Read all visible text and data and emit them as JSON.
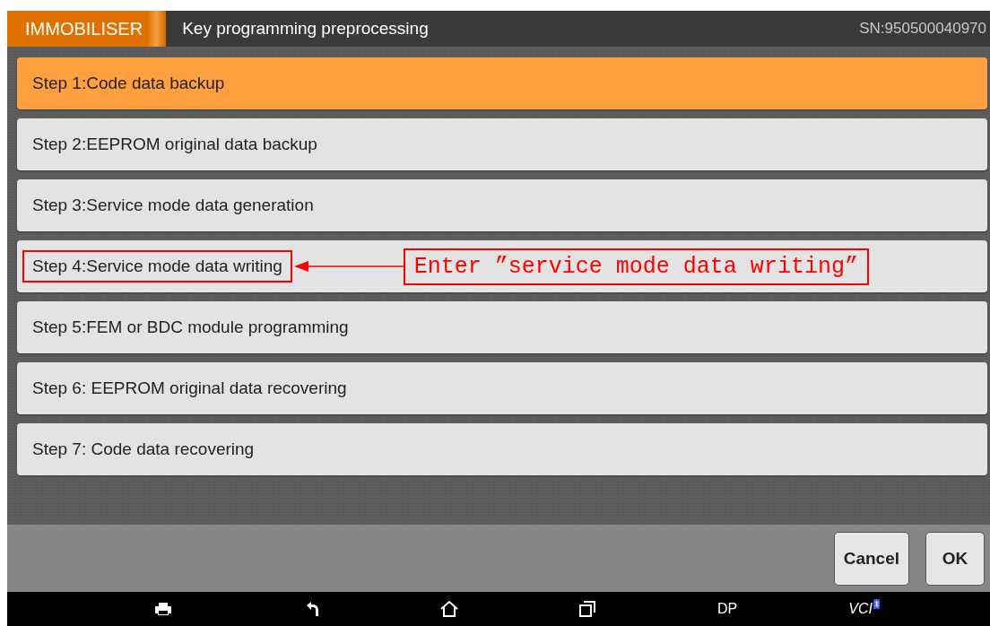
{
  "header": {
    "module": "IMMOBILISER",
    "title": "Key programming preprocessing",
    "serial": "SN:950500040970"
  },
  "steps": [
    {
      "label": "Step 1:Code data backup",
      "selected": true,
      "highlighted": false
    },
    {
      "label": "Step 2:EEPROM original data backup",
      "selected": false,
      "highlighted": false
    },
    {
      "label": "Step 3:Service mode data generation",
      "selected": false,
      "highlighted": false
    },
    {
      "label": "Step 4:Service mode data writing",
      "selected": false,
      "highlighted": true,
      "annotation": "Enter ”service mode data writing”"
    },
    {
      "label": "Step 5:FEM or BDC module programming",
      "selected": false,
      "highlighted": false
    },
    {
      "label": "Step 6: EEPROM original data recovering",
      "selected": false,
      "highlighted": false
    },
    {
      "label": "Step 7: Code data recovering",
      "selected": false,
      "highlighted": false
    }
  ],
  "buttons": [
    "Cancel",
    "OK"
  ],
  "navbar": {
    "dp": "DP",
    "vci": "VCI"
  }
}
